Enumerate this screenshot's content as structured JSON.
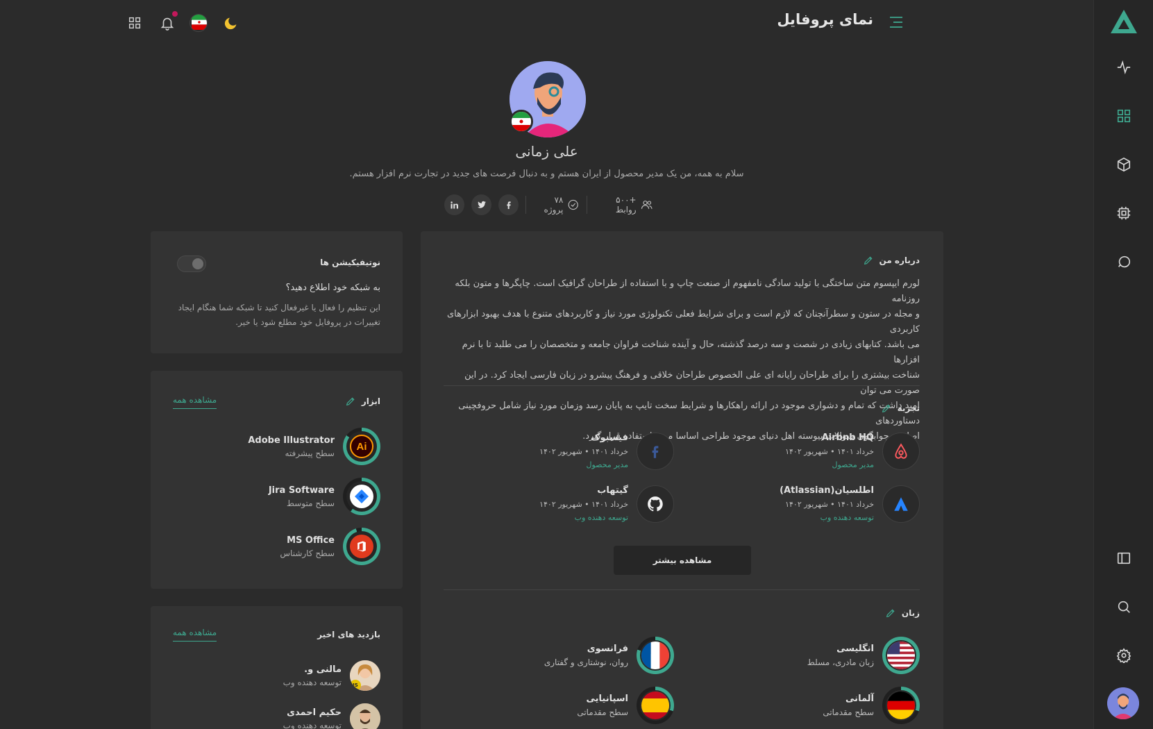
{
  "header": {
    "title": "نمای پروفایل"
  },
  "profile": {
    "name": "علی زمانی",
    "bio": "سلام به همه، من یک مدیر محصول از ایران هستم و به دنبال فرصت های جدید در تجارت نرم افزار هستم.",
    "connections": "+۵۰۰ روابط",
    "projects": "۷۸ پروژه",
    "social": [
      "in",
      "twitter",
      "facebook"
    ]
  },
  "about": {
    "title": "درباره من",
    "lines": [
      "لورم ایپسوم متن ساختگی با تولید سادگی نامفهوم از صنعت چاپ و با استفاده از طراحان گرافیک است. چاپگرها و متون بلکه روزنامه",
      "و مجله در ستون و سطرآنچنان که لازم است و برای شرایط فعلی تکنولوژی مورد نیاز و کاربردهای متنوع با هدف بهبود ابزارهای کاربردی",
      "می باشد. کتابهای زیادی در شصت و سه درصد گذشته، حال و آینده شناخت فراوان جامعه و متخصصان را می طلبد تا با نرم افزارها",
      "شناخت بیشتری را برای طراحان رایانه ای علی الخصوص طراحان خلاقی و فرهنگ پیشرو در زبان فارسی ایجاد کرد. در این صورت می توان",
      "امید داشت که تمام و دشواری موجود در ارائه راهکارها و شرایط سخت تایپ به پایان رسد وزمان مورد نیاز شامل حروفچینی دستاوردهای",
      "اصلی و جوابگوی سوالات پیوسته اهل دنیای موجود طراحی اساسا مورد استفاده قرار گیرد."
    ]
  },
  "experience": {
    "title": "تجربه",
    "more_label": "مشاهده بیشتر",
    "items": [
      {
        "company": "Airbnb HQ",
        "date": "خرداد ۱۴۰۱ • شهریور ۱۴۰۲",
        "role": "مدیر محصول",
        "icon": "airbnb-icon",
        "color": "#ff5a5f"
      },
      {
        "company": "فیسبوک",
        "date": "خرداد ۱۴۰۱ • شهریور ۱۴۰۲",
        "role": "مدیر محصول",
        "icon": "facebook-icon",
        "color": "#3b5998"
      },
      {
        "company": "اطلسیان(Atlassian)",
        "date": "خرداد ۱۴۰۱ • شهریور ۱۴۰۲",
        "role": "توسعه دهنده وب",
        "icon": "atlassian-icon",
        "color": "#2684ff"
      },
      {
        "company": "گیتهاب",
        "date": "خرداد ۱۴۰۱ • شهریور ۱۴۰۲",
        "role": "توسعه دهنده وب",
        "icon": "github-icon",
        "color": "#ffffff"
      }
    ]
  },
  "languages": {
    "title": "زبان",
    "items": [
      {
        "name": "انگلیسی",
        "level": "زبان مادری، مسلط",
        "icon": "us-flag-icon"
      },
      {
        "name": "فرانسوی",
        "level": "روان، نوشتاری و گفتاری",
        "icon": "fr-flag-icon"
      },
      {
        "name": "آلمانی",
        "level": "سطح مقدماتی",
        "icon": "de-flag-icon"
      },
      {
        "name": "اسپانیایی",
        "level": "سطح مقدماتی",
        "icon": "es-flag-icon"
      }
    ]
  },
  "notifications": {
    "title": "نوتیفیکیشن ها",
    "question": "به شبکه خود اطلاع دهید؟",
    "desc_lines": [
      "این تنظیم را فعال یا غیرفعال کنید تا شبکه شما هنگام ایجاد",
      "تغییرات در پروفایل خود مطلع شود یا خیر."
    ],
    "enabled": false
  },
  "tools": {
    "title": "ابزار",
    "view_all": "مشاهده همه",
    "items": [
      {
        "name": "Adobe Illustrator",
        "level": "سطح پیشرفته",
        "icon": "illustrator-icon",
        "progress": 0.85
      },
      {
        "name": "Jira Software",
        "level": "سطح متوسط",
        "icon": "jira-icon",
        "progress": 0.6
      },
      {
        "name": "MS Office",
        "level": "سطح کارشناس",
        "icon": "office-icon",
        "progress": 0.95
      }
    ]
  },
  "visitors": {
    "title": "بازدید های اخیر",
    "view_all": "مشاهده همه",
    "items": [
      {
        "name": "مالنی و.",
        "role": "توسعه دهنده وب",
        "badge": "JS"
      },
      {
        "name": "حکیم احمدی",
        "role": "توسعه دهنده وب",
        "badge": ""
      }
    ]
  },
  "colors": {
    "accent": "#3ea88f",
    "background": "#2b2b2b",
    "card": "#333333"
  }
}
